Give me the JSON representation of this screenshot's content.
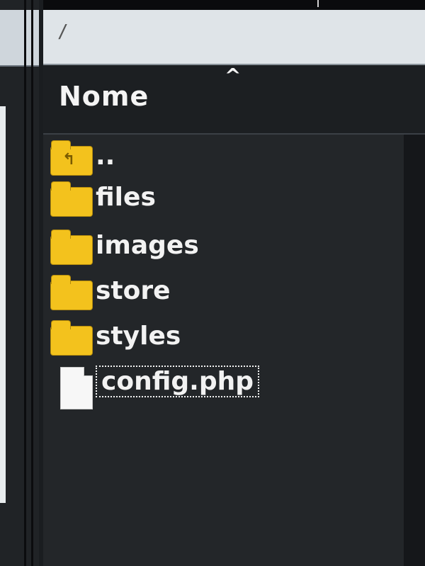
{
  "path_bar": {
    "path": "/"
  },
  "header": {
    "sort_indicator": "^",
    "name_column": "Nome"
  },
  "file_list": {
    "rows": [
      {
        "name": "..",
        "type": "parent-folder",
        "icon": "folder-up-icon"
      },
      {
        "name": "files",
        "type": "folder",
        "icon": "folder-icon"
      },
      {
        "name": "images",
        "type": "folder",
        "icon": "folder-icon"
      },
      {
        "name": "store",
        "type": "folder",
        "icon": "folder-icon"
      },
      {
        "name": "styles",
        "type": "folder",
        "icon": "folder-icon"
      },
      {
        "name": "config.php",
        "type": "file",
        "icon": "file-icon",
        "selected": true
      }
    ]
  },
  "colors": {
    "folder": "#f3c21d",
    "background": "#232629",
    "text": "#f2f2f2"
  }
}
